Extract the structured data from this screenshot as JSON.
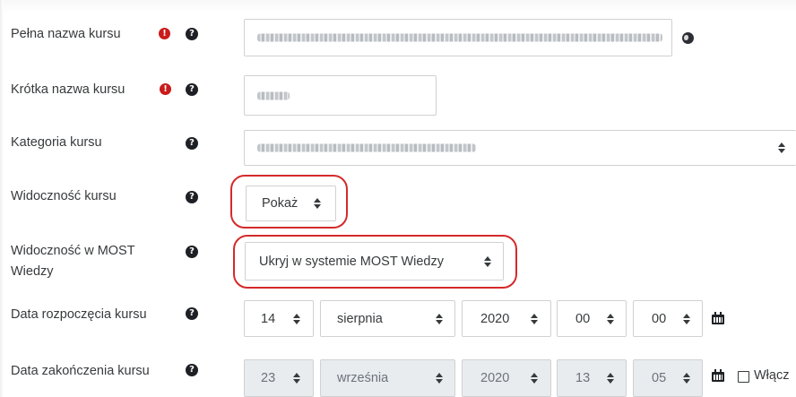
{
  "form": {
    "fullname": {
      "label": "Pełna nazwa kursu",
      "required": true
    },
    "shortname": {
      "label": "Krótka nazwa kursu",
      "required": true
    },
    "category": {
      "label": "Kategoria kursu"
    },
    "visibility": {
      "label": "Widoczność kursu",
      "value": "Pokaż"
    },
    "most_visibility": {
      "label_line1": "Widoczność w MOST",
      "label_line2": "Wiedzy",
      "value": "Ukryj w systemie MOST Wiedzy"
    },
    "start_date": {
      "label": "Data rozpoczęcia kursu",
      "day": "14",
      "month": "sierpnia",
      "year": "2020",
      "hour": "00",
      "minute": "00"
    },
    "end_date": {
      "label": "Data zakończenia kursu",
      "day": "23",
      "month": "września",
      "year": "2020",
      "hour": "13",
      "minute": "05",
      "enable_label": "Włącz"
    }
  },
  "icons": {
    "required": "exclamation-circle-icon",
    "help": "question-circle-icon",
    "globe": "globe-icon",
    "calendar": "calendar-icon"
  },
  "colors": {
    "required": "#ca1b1b",
    "highlight": "#d42a2a",
    "help": "#1d2125",
    "border": "#cfd1d3",
    "disabled_bg": "#e9ecef"
  }
}
